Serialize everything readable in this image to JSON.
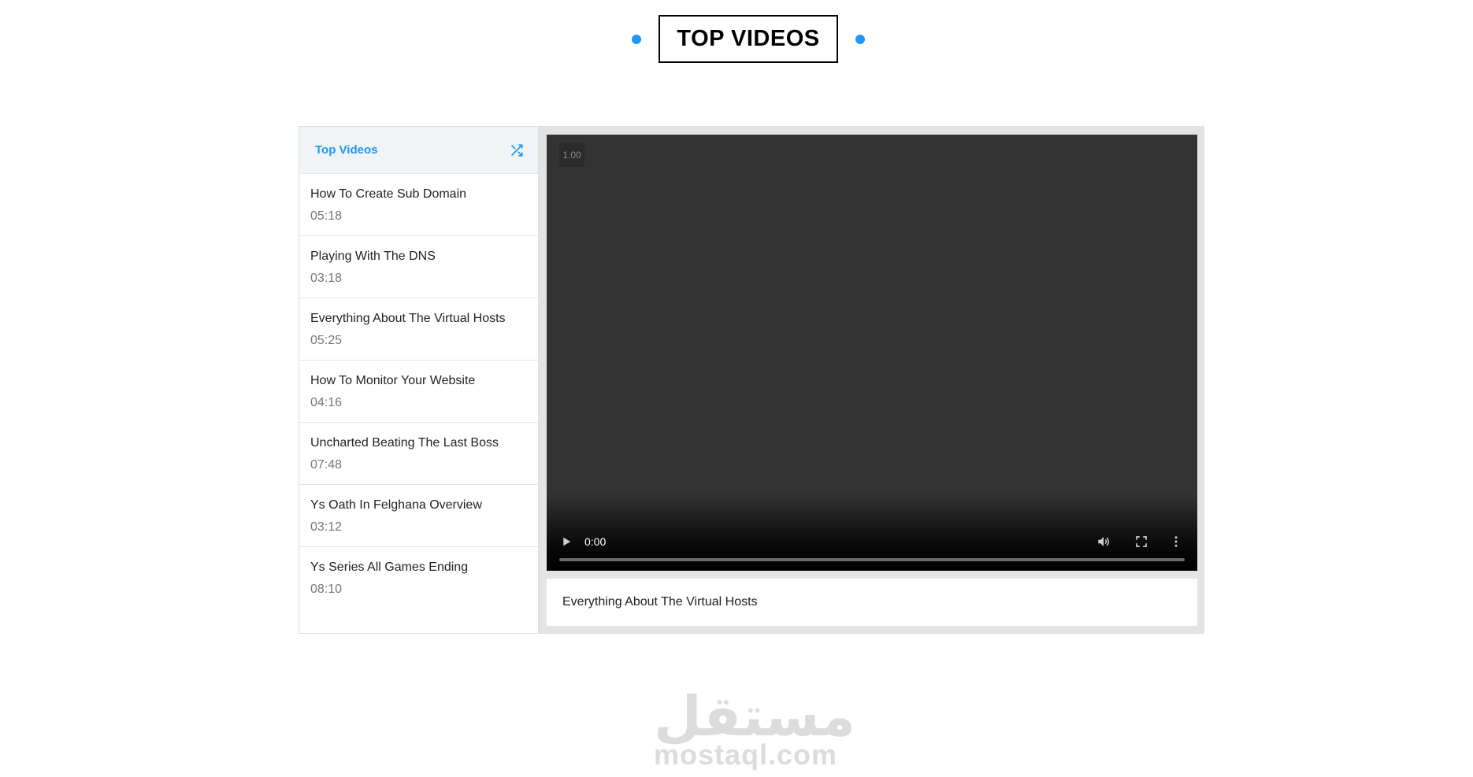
{
  "section": {
    "heading": "TOP VIDEOS"
  },
  "colors": {
    "accent": "#2196f3",
    "player_bg": "#333333"
  },
  "sidebar": {
    "title": "Top Videos",
    "shuffle_icon": "shuffle-icon",
    "videos": [
      {
        "title": "How To Create Sub Domain",
        "duration": "05:18"
      },
      {
        "title": "Playing With The DNS",
        "duration": "03:18"
      },
      {
        "title": "Everything About The Virtual Hosts",
        "duration": "05:25"
      },
      {
        "title": "How To Monitor Your Website",
        "duration": "04:16"
      },
      {
        "title": "Uncharted Beating The Last Boss",
        "duration": "07:48"
      },
      {
        "title": "Ys Oath In Felghana Overview",
        "duration": "03:12"
      },
      {
        "title": "Ys Series All Games Ending",
        "duration": "08:10"
      }
    ]
  },
  "player": {
    "speed": "1.00",
    "time": "0:00",
    "progress": 0,
    "icons": [
      "play-icon",
      "volume-icon",
      "fullscreen-icon",
      "more-vert-icon"
    ]
  },
  "caption": {
    "title": "Everything About The Virtual Hosts"
  },
  "watermark": {
    "arabic": "مستقل",
    "latin": "mostaql.com"
  }
}
